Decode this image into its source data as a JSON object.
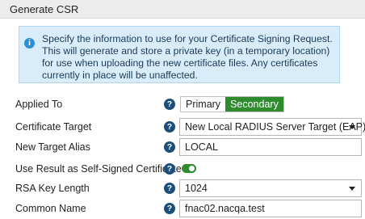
{
  "window": {
    "title": "Generate CSR"
  },
  "info": {
    "icon": "info-icon",
    "text": "Specify the information to use for your Certificate Signing Request. This will generate and store a private key (in a temporary location) for use when uploading the new certificate files. Any certificates currently in place will be unaffected."
  },
  "form": {
    "applied_to": {
      "label": "Applied To",
      "options": [
        "Primary",
        "Secondary"
      ],
      "selected": "Secondary"
    },
    "certificate_target": {
      "label": "Certificate Target",
      "value": "New Local RADIUS Server Target (EAP)"
    },
    "new_target_alias": {
      "label": "New Target Alias",
      "value": "LOCAL"
    },
    "self_signed": {
      "label": "Use Result as Self-Signed Certificate",
      "enabled": true
    },
    "rsa_key_length": {
      "label": "RSA Key Length",
      "value": "1024"
    },
    "common_name": {
      "label": "Common Name",
      "value": "fnac02.nacqa.test"
    },
    "help_glyph": "?"
  },
  "colors": {
    "accent_green": "#2e8b2e",
    "info_bg": "#d9ecfa",
    "help_icon": "#1b4f7a"
  }
}
